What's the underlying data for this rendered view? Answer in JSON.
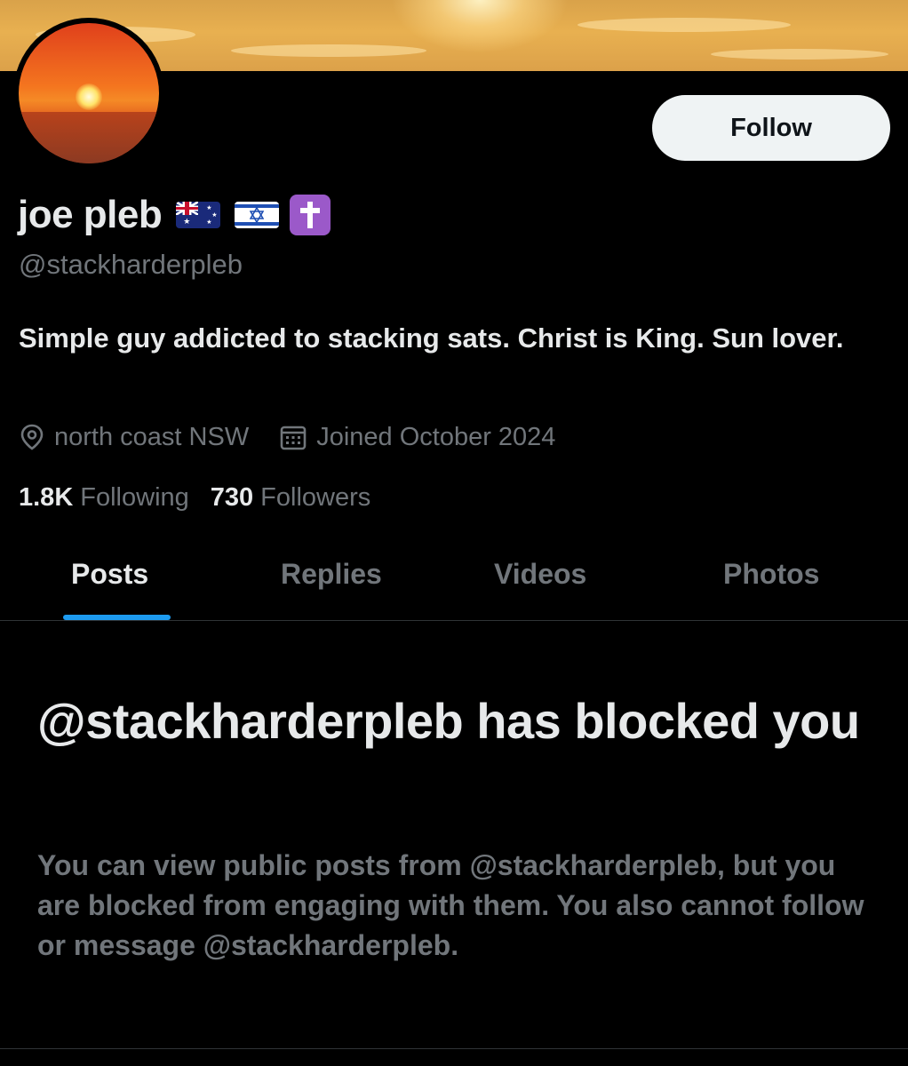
{
  "profile": {
    "display_name": "joe pleb",
    "name_emojis": [
      "australia-flag",
      "israel-flag",
      "latin-cross"
    ],
    "handle": "@stackharderpleb",
    "bio": "Simple guy addicted to stacking sats. Christ is King. Sun lover.",
    "location": "north coast NSW",
    "joined": "Joined October 2024",
    "following_count": "1.8K",
    "following_label": "Following",
    "followers_count": "730",
    "followers_label": "Followers"
  },
  "actions": {
    "follow_label": "Follow"
  },
  "tabs": [
    {
      "label": "Posts",
      "active": true
    },
    {
      "label": "Replies",
      "active": false
    },
    {
      "label": "Videos",
      "active": false
    },
    {
      "label": "Photos",
      "active": false
    }
  ],
  "blocked_notice": {
    "title": "@stackharderpleb has blocked you",
    "description": "You can view public posts from @stackharderpleb, but you are blocked from engaging with them. You also cannot follow or message @stackharderpleb."
  },
  "icons": {
    "location": "location-pin-icon",
    "joined": "calendar-icon"
  },
  "colors": {
    "background": "#000000",
    "primary_text": "#e7e9ea",
    "secondary_text": "#71767b",
    "accent": "#1d9bf0",
    "follow_button_bg": "#eff3f4",
    "divider": "#2f3336"
  }
}
